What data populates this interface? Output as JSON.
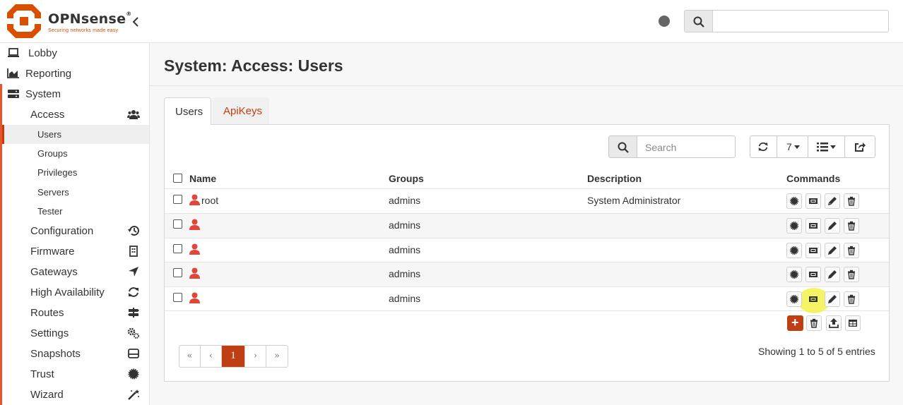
{
  "brand": {
    "name": "OPNsense",
    "registered": "®",
    "tagline": "Securing networks made easy"
  },
  "header": {
    "search_placeholder": ""
  },
  "sidebar": {
    "top": [
      {
        "label": "Lobby",
        "icon": "laptop-icon"
      },
      {
        "label": "Reporting",
        "icon": "area-chart-icon"
      },
      {
        "label": "System",
        "icon": "server-icon"
      }
    ],
    "access": {
      "label": "Access",
      "icon": "users-icon"
    },
    "access_items": [
      "Users",
      "Groups",
      "Privileges",
      "Servers",
      "Tester"
    ],
    "categories": [
      {
        "label": "Configuration",
        "icon": "history-icon"
      },
      {
        "label": "Firmware",
        "icon": "building-icon"
      },
      {
        "label": "Gateways",
        "icon": "location-arrow-icon"
      },
      {
        "label": "High Availability",
        "icon": "refresh-icon"
      },
      {
        "label": "Routes",
        "icon": "map-signs-icon"
      },
      {
        "label": "Settings",
        "icon": "cogs-icon"
      },
      {
        "label": "Snapshots",
        "icon": "hdd-icon"
      },
      {
        "label": "Trust",
        "icon": "certificate-icon"
      },
      {
        "label": "Wizard",
        "icon": "magic-icon"
      }
    ]
  },
  "main": {
    "title": "System: Access: Users",
    "tabs": [
      "Users",
      "ApiKeys"
    ],
    "search_placeholder": "Search",
    "page_size": "7",
    "columns": [
      "Name",
      "Groups",
      "Description",
      "Commands"
    ],
    "rows": [
      {
        "name": "root",
        "groups": "admins",
        "description": "System Administrator"
      },
      {
        "name": "",
        "groups": "admins",
        "description": ""
      },
      {
        "name": "",
        "groups": "admins",
        "description": ""
      },
      {
        "name": "",
        "groups": "admins",
        "description": ""
      },
      {
        "name": "",
        "groups": "admins",
        "description": ""
      }
    ],
    "add_label": "+",
    "pagination": [
      "«",
      "‹",
      "1",
      "›",
      "»"
    ],
    "current_page": "1",
    "info": "Showing 1 to 5 of 5 entries"
  },
  "colors": {
    "brand": "#d94f00",
    "accent": "#c03e14",
    "user_icon": "#e0473a",
    "highlight": "#f2f24a"
  }
}
